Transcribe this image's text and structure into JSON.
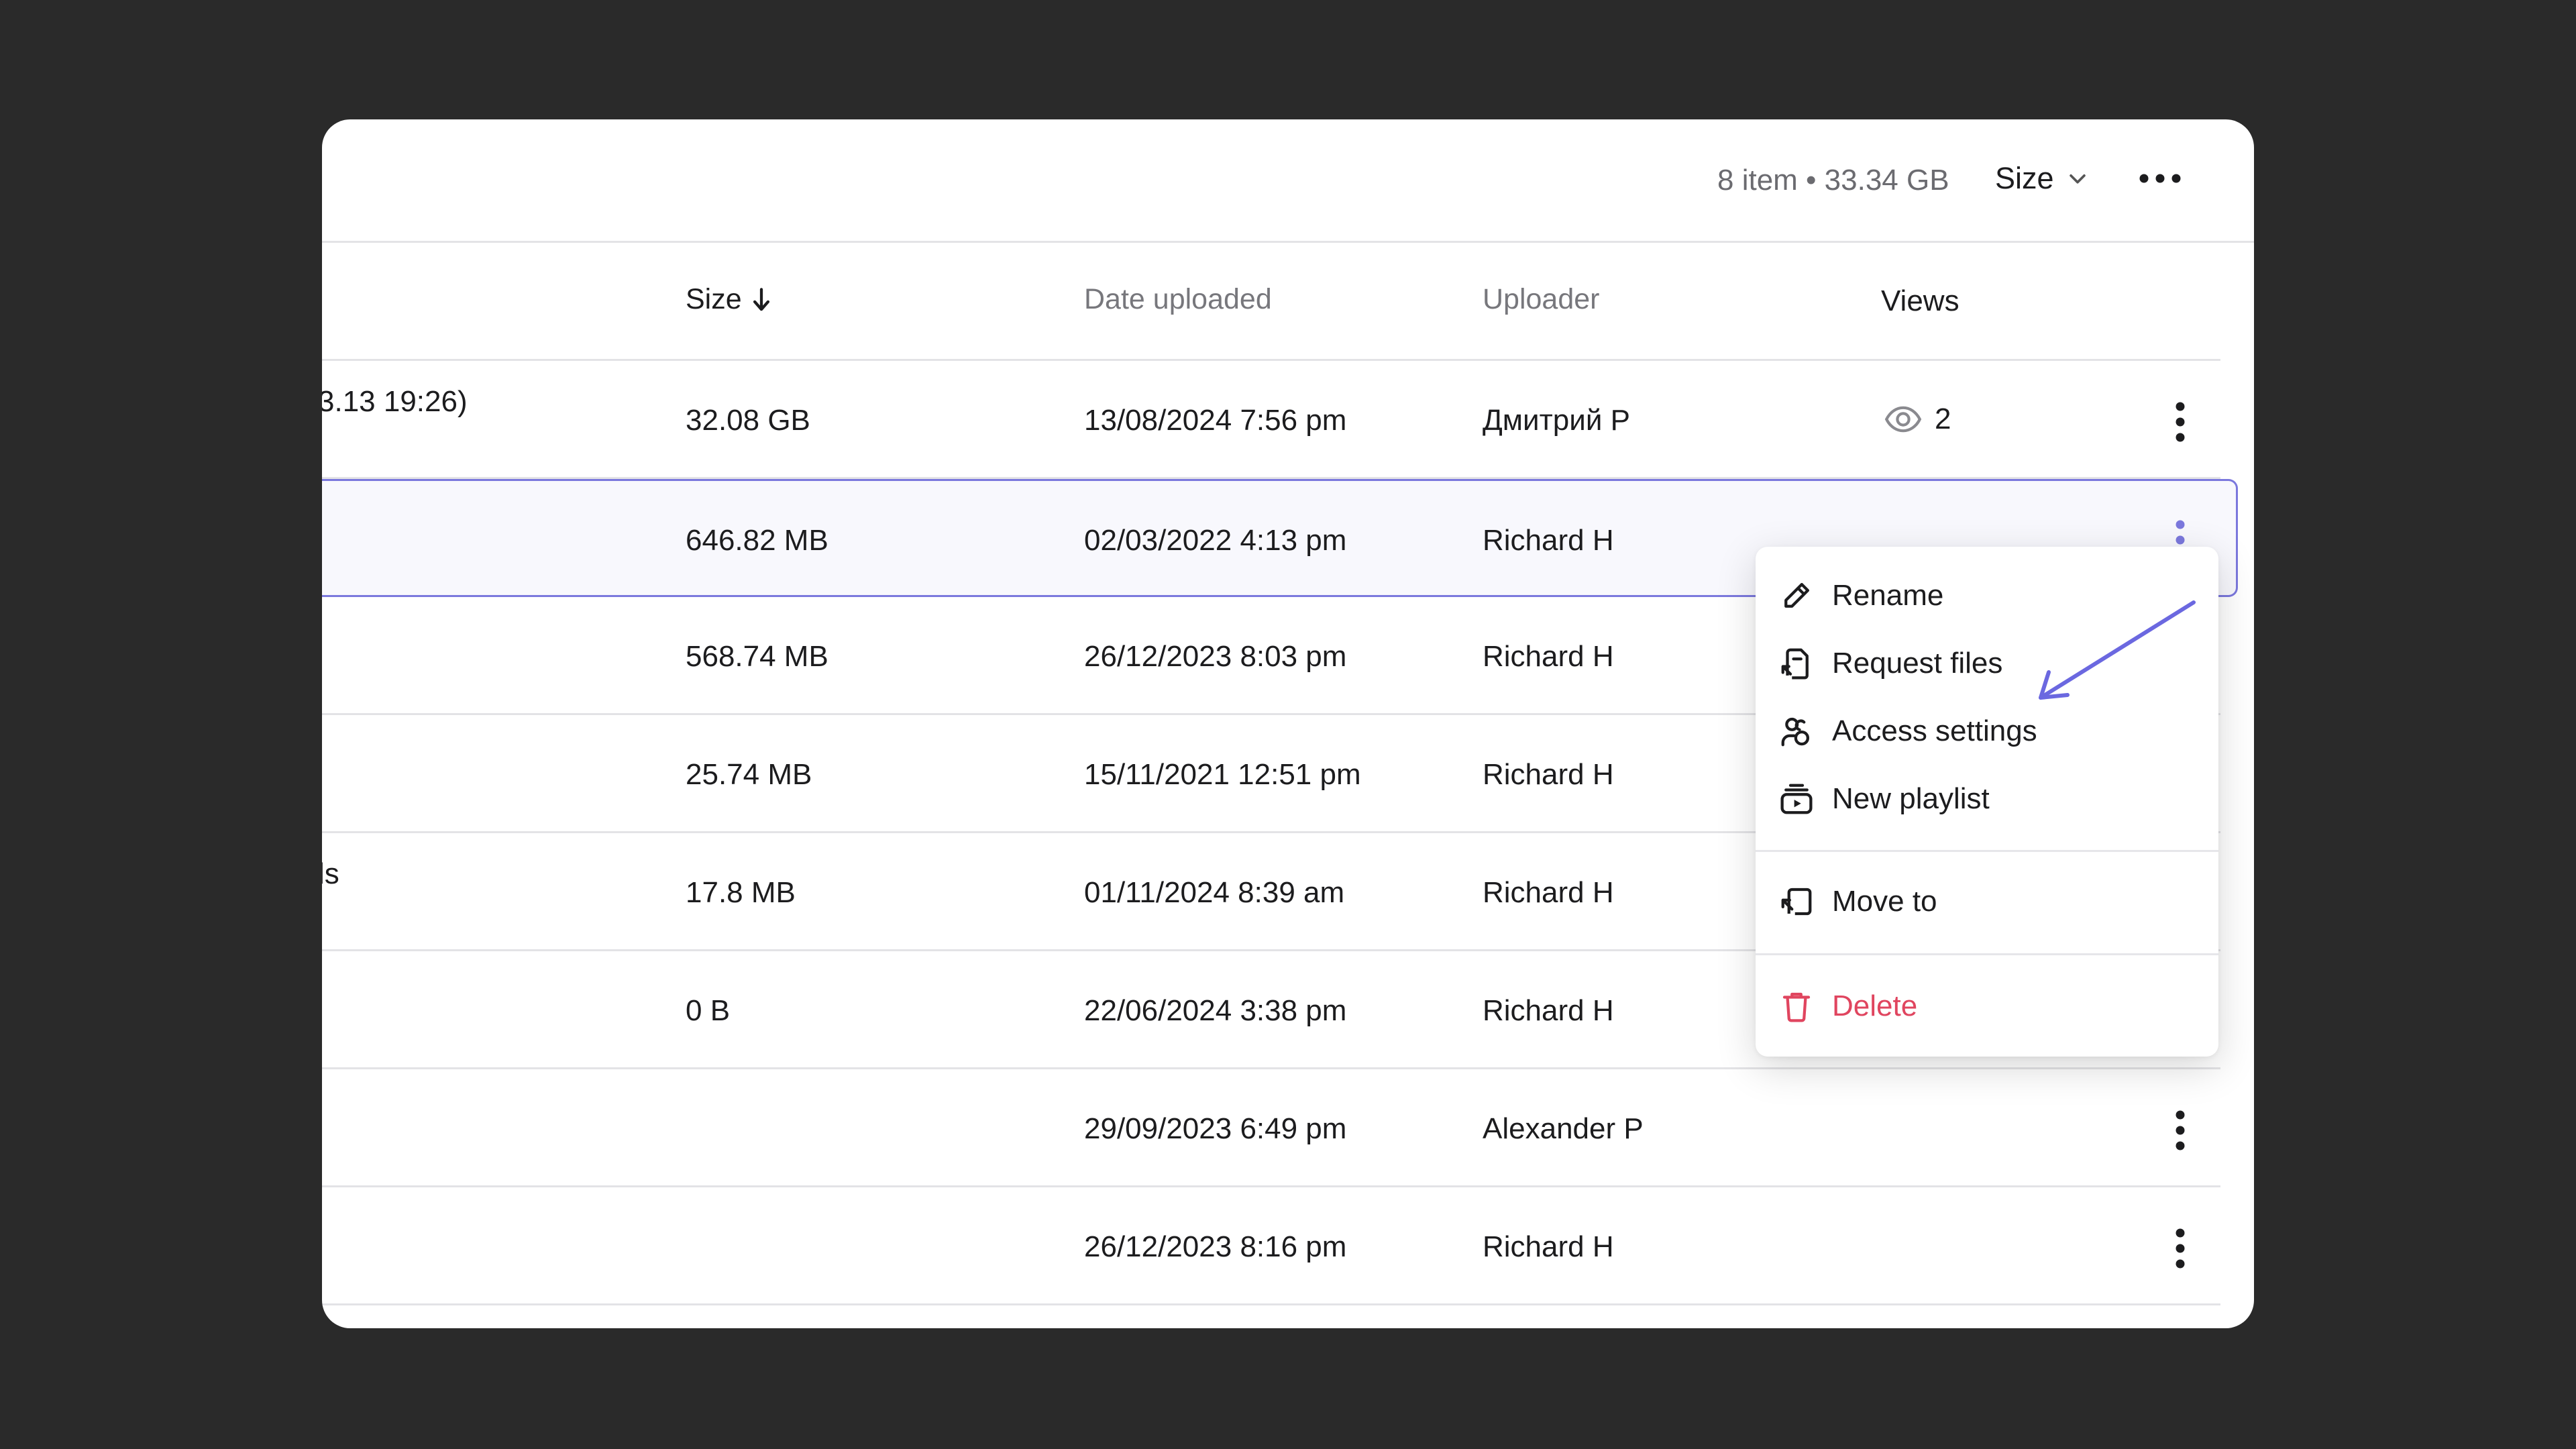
{
  "toolbar": {
    "summary": "8 item • 33.34 GB",
    "sort_label": "Size"
  },
  "table": {
    "columns": {
      "size": "Size",
      "date": "Date uploaded",
      "uploader": "Uploader",
      "views": "Views"
    },
    "rows": [
      {
        "name": "3.13 19:26)",
        "size": "32.08 GB",
        "date": "13/08/2024 7:56 pm",
        "uploader": "Дмитрий Р",
        "views": "2"
      },
      {
        "name": "",
        "size": "646.82 MB",
        "date": "02/03/2022 4:13 pm",
        "uploader": "Richard H"
      },
      {
        "name": "",
        "size": "568.74 MB",
        "date": "26/12/2023 8:03 pm",
        "uploader": "Richard H"
      },
      {
        "name": "",
        "size": "25.74 MB",
        "date": "15/11/2021 12:51 pm",
        "uploader": "Richard H"
      },
      {
        "name": "ls",
        "size": "17.8 MB",
        "date": "01/11/2024 8:39 am",
        "uploader": "Richard H"
      },
      {
        "name": "",
        "size": "0 B",
        "date": "22/06/2024 3:38 pm",
        "uploader": "Richard H"
      },
      {
        "name": "",
        "size": "",
        "date": "29/09/2023 6:49 pm",
        "uploader": "Alexander P"
      },
      {
        "name": "",
        "size": "",
        "date": "26/12/2023 8:16 pm",
        "uploader": "Richard H"
      }
    ]
  },
  "context_menu": {
    "items": [
      {
        "label": "Rename",
        "icon": "pencil-icon"
      },
      {
        "label": "Request files",
        "icon": "request-files-icon"
      },
      {
        "label": "Access settings",
        "icon": "users-icon"
      },
      {
        "label": "New playlist",
        "icon": "playlist-icon"
      },
      {
        "label": "Move to",
        "icon": "move-icon"
      },
      {
        "label": "Delete",
        "icon": "trash-icon"
      }
    ]
  },
  "colors": {
    "background": "#2a2a2a",
    "panel": "#ffffff",
    "selected_row_border": "#7b78dd",
    "danger": "#e0455f",
    "annotation_arrow": "#6b68e0"
  }
}
